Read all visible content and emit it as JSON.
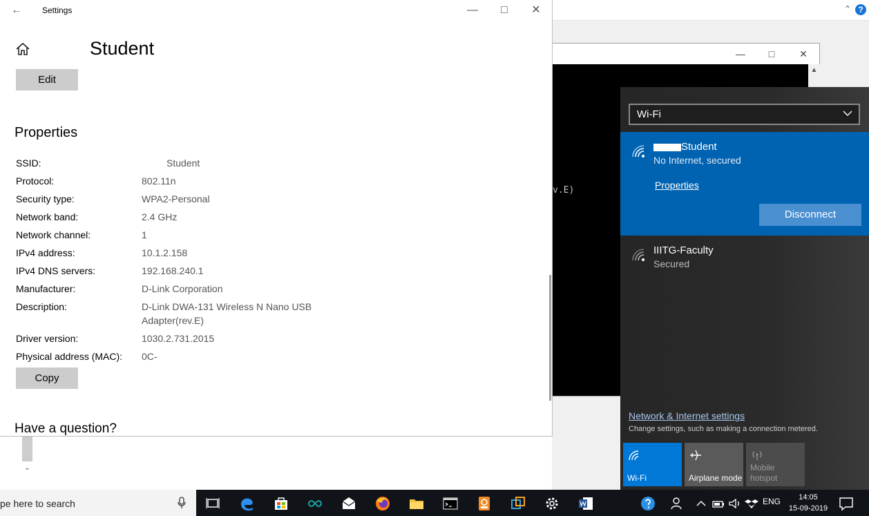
{
  "settings": {
    "window_title": "Settings",
    "network_name": "Student",
    "edit_label": "Edit",
    "properties_heading": "Properties",
    "properties": [
      {
        "label": "SSID:",
        "value": "Student"
      },
      {
        "label": "Protocol:",
        "value": "802.11n"
      },
      {
        "label": "Security type:",
        "value": "WPA2-Personal"
      },
      {
        "label": "Network band:",
        "value": "2.4 GHz"
      },
      {
        "label": "Network channel:",
        "value": "1"
      },
      {
        "label": "IPv4 address:",
        "value": "10.1.2.158"
      },
      {
        "label": "IPv4 DNS servers:",
        "value": "192.168.240.1"
      },
      {
        "label": "Manufacturer:",
        "value": "D-Link Corporation"
      },
      {
        "label": "Description:",
        "value": "D-Link DWA-131 Wireless N Nano USB Adapter(rev.E)"
      },
      {
        "label": "Driver version:",
        "value": "1030.2.731.2015"
      },
      {
        "label": "Physical address (MAC):",
        "value": "0C-"
      }
    ],
    "copy_label": "Copy",
    "question_heading": "Have a question?"
  },
  "console": {
    "visible_text": "v.E)"
  },
  "wifi_flyout": {
    "dropdown_value": "Wi-Fi",
    "networks": [
      {
        "name": "Student",
        "status": "No Internet, secured",
        "properties_link": "Properties",
        "action": "Disconnect"
      },
      {
        "name": "IIITG-Faculty",
        "status": "Secured"
      }
    ],
    "settings_link": "Network & Internet settings",
    "settings_desc": "Change settings, such as making a connection metered.",
    "tiles": [
      {
        "label": "Wi-Fi",
        "icon": "wifi-icon",
        "state": "on"
      },
      {
        "label": "Airplane mode",
        "icon": "airplane-icon",
        "state": "off"
      },
      {
        "label": "Mobile hotspot",
        "icon": "hotspot-icon",
        "state": "disabled"
      }
    ],
    "accent_color": "#0063b1"
  },
  "taskbar": {
    "search_placeholder": "pe here to search",
    "language": "ENG",
    "time": "14:05",
    "date": "15-09-2019"
  }
}
